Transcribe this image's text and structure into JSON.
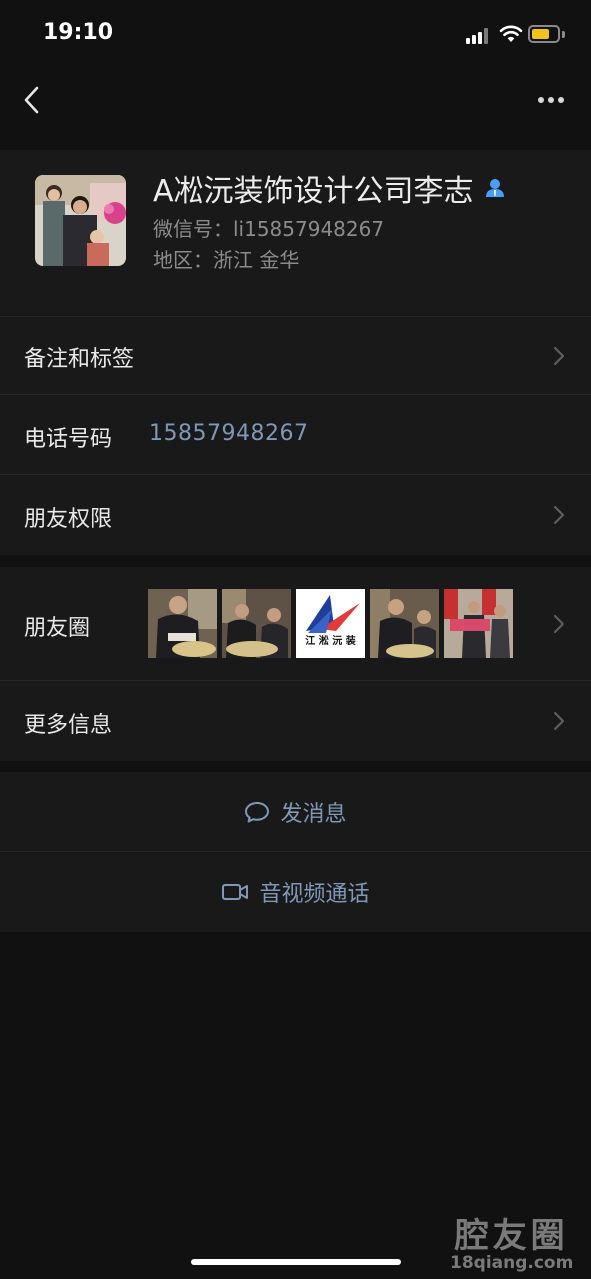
{
  "status_bar": {
    "time": "19:10"
  },
  "profile": {
    "name": "A凇沅装饰设计公司李志",
    "wechat_id": "微信号：li15857948267",
    "region": "地区：浙江 金华"
  },
  "rows": {
    "remarks_tags": "备注和标签",
    "phone_label": "电话号码",
    "phone_value": "15857948267",
    "friend_permissions": "朋友权限",
    "moments": "朋友圈",
    "more_info": "更多信息"
  },
  "moments_logo_text": "江 淞 沅 装",
  "actions": {
    "send_message": "发消息",
    "video_call": "音视频通话"
  },
  "watermark": {
    "main": "腔友圈",
    "sub": "18qiang.com"
  },
  "colors": {
    "background": "#111111",
    "cell": "#191919",
    "link_blue": "#8097b8",
    "battery": "#f2c21c",
    "contact_icon": "#4a9ff5"
  }
}
